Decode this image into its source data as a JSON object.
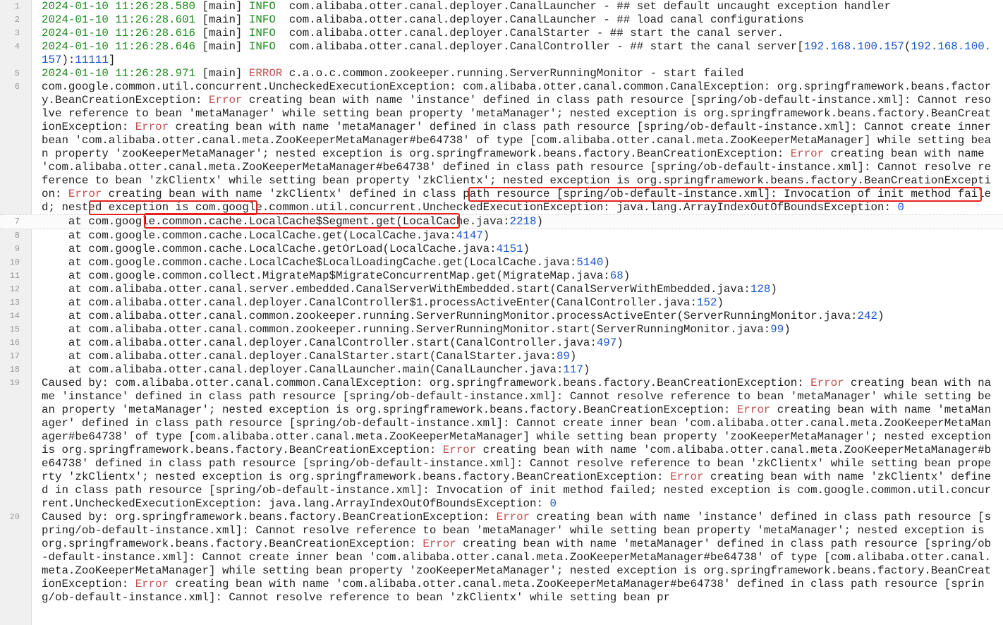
{
  "lines": [
    {
      "n": "1",
      "segs": [
        {
          "t": "2024-01-10 11:26:28.580",
          "c": "ts"
        },
        {
          "t": " [main] "
        },
        {
          "t": "INFO",
          "c": "info"
        },
        {
          "t": "  com.alibaba.otter.canal.deployer.CanalLauncher - ## set default uncaught exception handler"
        }
      ]
    },
    {
      "n": "2",
      "segs": [
        {
          "t": "2024-01-10 11:26:28.601",
          "c": "ts"
        },
        {
          "t": " [main] "
        },
        {
          "t": "INFO",
          "c": "info"
        },
        {
          "t": "  com.alibaba.otter.canal.deployer.CanalLauncher - ## load canal configurations"
        }
      ]
    },
    {
      "n": "3",
      "segs": [
        {
          "t": "2024-01-10 11:26:28.616",
          "c": "ts"
        },
        {
          "t": " [main] "
        },
        {
          "t": "INFO",
          "c": "info"
        },
        {
          "t": "  com.alibaba.otter.canal.deployer.CanalStarter - ## start the canal server."
        }
      ]
    },
    {
      "n": "4",
      "segs": [
        {
          "t": "2024-01-10 11:26:28.646",
          "c": "ts"
        },
        {
          "t": " [main] "
        },
        {
          "t": "INFO",
          "c": "info"
        },
        {
          "t": "  com.alibaba.otter.canal.deployer.CanalController - ## start the canal server["
        },
        {
          "t": "192.168.100.157",
          "c": "num"
        },
        {
          "t": "("
        },
        {
          "t": "192.168.100.157",
          "c": "num"
        },
        {
          "t": "):"
        },
        {
          "t": "11111",
          "c": "num"
        },
        {
          "t": "]"
        }
      ]
    },
    {
      "n": "5",
      "segs": [
        {
          "t": "2024-01-10 11:26:28.971",
          "c": "ts"
        },
        {
          "t": " [main] "
        },
        {
          "t": "ERROR",
          "c": "err"
        },
        {
          "t": " c.a.o.c.common.zookeeper.running.ServerRunningMonitor - start failed"
        }
      ]
    },
    {
      "n": "6",
      "segs": [
        {
          "t": "com.google.common.util.concurrent.UncheckedExecutionException: com.alibaba.otter.canal.common.CanalException: org.springframework.beans.factory.BeanCreationException: "
        },
        {
          "t": "Error",
          "c": "err"
        },
        {
          "t": " creating bean with name 'instance' defined in class path resource [spring/ob-default-instance.xml]: Cannot resolve reference to bean 'metaManager' while setting bean property 'metaManager'; nested exception is org.springframework.beans.factory.BeanCreationException: "
        },
        {
          "t": "Error",
          "c": "err"
        },
        {
          "t": " creating bean with name 'metaManager' defined in class path resource [spring/ob-default-instance.xml]: Cannot create inner bean 'com.alibaba.otter.canal.meta.ZooKeeperMetaManager#be64738' of type [com.alibaba.otter.canal.meta.ZooKeeperMetaManager] while setting bean property 'zooKeeperMetaManager'; nested exception is org.springframework.beans.factory.BeanCreationException: "
        },
        {
          "t": "Error",
          "c": "err"
        },
        {
          "t": " creating bean with name 'com.alibaba.otter.canal.meta.ZooKeeperMetaManager#be64738' defined in class path resource [spring/ob-default-instance.xml]: Cannot resolve reference to bean 'zkClientx' while setting bean property 'zkClientx'; nested exception is org.springframework.beans.factory.BeanCreationException: "
        },
        {
          "t": "Error",
          "c": "err"
        },
        {
          "t": " creating bean with name 'zkClientx' defined in class path resource [spring/ob-default-instance.xml]: Invocation of init method failed; nested exception is com.google.common.util.concurrent.UncheckedExecutionException: java.lang.ArrayIndexOutOfBoundsException: "
        },
        {
          "t": "0",
          "c": "num"
        }
      ]
    },
    {
      "n": "7",
      "current": true,
      "segs": [
        {
          "t": "    at com.google.common.cache.LocalCache$Segment.get(LocalCache.java:"
        },
        {
          "t": "2218",
          "c": "num"
        },
        {
          "t": ")"
        }
      ]
    },
    {
      "n": "8",
      "segs": [
        {
          "t": "    at com.google.common.cache.LocalCache.get(LocalCache.java:"
        },
        {
          "t": "4147",
          "c": "num"
        },
        {
          "t": ")"
        }
      ]
    },
    {
      "n": "9",
      "segs": [
        {
          "t": "    at com.google.common.cache.LocalCache.getOrLoad(LocalCache.java:"
        },
        {
          "t": "4151",
          "c": "num"
        },
        {
          "t": ")"
        }
      ]
    },
    {
      "n": "10",
      "segs": [
        {
          "t": "    at com.google.common.cache.LocalCache$LocalLoadingCache.get(LocalCache.java:"
        },
        {
          "t": "5140",
          "c": "num"
        },
        {
          "t": ")"
        }
      ]
    },
    {
      "n": "11",
      "segs": [
        {
          "t": "    at com.google.common.collect.MigrateMap$MigrateConcurrentMap.get(MigrateMap.java:"
        },
        {
          "t": "68",
          "c": "num"
        },
        {
          "t": ")"
        }
      ]
    },
    {
      "n": "12",
      "segs": [
        {
          "t": "    at com.alibaba.otter.canal.server.embedded.CanalServerWithEmbedded.start(CanalServerWithEmbedded.java:"
        },
        {
          "t": "128",
          "c": "num"
        },
        {
          "t": ")"
        }
      ]
    },
    {
      "n": "13",
      "segs": [
        {
          "t": "    at com.alibaba.otter.canal.deployer.CanalController$1.processActiveEnter(CanalController.java:"
        },
        {
          "t": "152",
          "c": "num"
        },
        {
          "t": ")"
        }
      ]
    },
    {
      "n": "14",
      "segs": [
        {
          "t": "    at com.alibaba.otter.canal.common.zookeeper.running.ServerRunningMonitor.processActiveEnter(ServerRunningMonitor.java:"
        },
        {
          "t": "242",
          "c": "num"
        },
        {
          "t": ")"
        }
      ]
    },
    {
      "n": "15",
      "segs": [
        {
          "t": "    at com.alibaba.otter.canal.common.zookeeper.running.ServerRunningMonitor.start(ServerRunningMonitor.java:"
        },
        {
          "t": "99",
          "c": "num"
        },
        {
          "t": ")"
        }
      ]
    },
    {
      "n": "16",
      "segs": [
        {
          "t": "    at com.alibaba.otter.canal.deployer.CanalController.start(CanalController.java:"
        },
        {
          "t": "497",
          "c": "num"
        },
        {
          "t": ")"
        }
      ]
    },
    {
      "n": "17",
      "segs": [
        {
          "t": "    at com.alibaba.otter.canal.deployer.CanalStarter.start(CanalStarter.java:"
        },
        {
          "t": "89",
          "c": "num"
        },
        {
          "t": ")"
        }
      ]
    },
    {
      "n": "18",
      "segs": [
        {
          "t": "    at com.alibaba.otter.canal.deployer.CanalLauncher.main(CanalLauncher.java:"
        },
        {
          "t": "117",
          "c": "num"
        },
        {
          "t": ")"
        }
      ]
    },
    {
      "n": "19",
      "segs": [
        {
          "t": "Caused by: com.alibaba.otter.canal.common.CanalException: org.springframework.beans.factory.BeanCreationException: "
        },
        {
          "t": "Error",
          "c": "err"
        },
        {
          "t": " creating bean with name 'instance' defined in class path resource [spring/ob-default-instance.xml]: Cannot resolve reference to bean 'metaManager' while setting bean property 'metaManager'; nested exception is org.springframework.beans.factory.BeanCreationException: "
        },
        {
          "t": "Error",
          "c": "err"
        },
        {
          "t": " creating bean with name 'metaManager' defined in class path resource [spring/ob-default-instance.xml]: Cannot create inner bean 'com.alibaba.otter.canal.meta.ZooKeeperMetaManager#be64738' of type [com.alibaba.otter.canal.meta.ZooKeeperMetaManager] while setting bean property 'zooKeeperMetaManager'; nested exception is org.springframework.beans.factory.BeanCreationException: "
        },
        {
          "t": "Error",
          "c": "err"
        },
        {
          "t": " creating bean with name 'com.alibaba.otter.canal.meta.ZooKeeperMetaManager#be64738' defined in class path resource [spring/ob-default-instance.xml]: Cannot resolve reference to bean 'zkClientx' while setting bean property 'zkClientx'; nested exception is org.springframework.beans.factory.BeanCreationException: "
        },
        {
          "t": "Error",
          "c": "err"
        },
        {
          "t": " creating bean with name 'zkClientx' defined in class path resource [spring/ob-default-instance.xml]: Invocation of init method failed; nested exception is com.google.common.util.concurrent.UncheckedExecutionException: java.lang.ArrayIndexOutOfBoundsException: "
        },
        {
          "t": "0",
          "c": "num"
        }
      ]
    },
    {
      "n": "20",
      "segs": [
        {
          "t": "Caused by: org.springframework.beans.factory.BeanCreationException: "
        },
        {
          "t": "Error",
          "c": "err"
        },
        {
          "t": " creating bean with name 'instance' defined in class path resource [spring/ob-default-instance.xml]: Cannot resolve reference to bean 'metaManager' while setting bean property 'metaManager'; nested exception is org.springframework.beans.factory.BeanCreationException: "
        },
        {
          "t": "Error",
          "c": "err"
        },
        {
          "t": " creating bean with name 'metaManager' defined in class path resource [spring/ob-default-instance.xml]: Cannot create inner bean 'com.alibaba.otter.canal.meta.ZooKeeperMetaManager#be64738' of type [com.alibaba.otter.canal.meta.ZooKeeperMetaManager] while setting bean property 'zooKeeperMetaManager'; nested exception is org.springframework.beans.factory.BeanCreationException: "
        },
        {
          "t": "Error",
          "c": "err"
        },
        {
          "t": " creating bean with name 'com.alibaba.otter.canal.meta.ZooKeeperMetaManager#be64738' defined in class path resource [spring/ob-default-instance.xml]: Cannot resolve reference to bean 'zkClientx' while setting bean pr"
        }
      ]
    }
  ],
  "colors": {
    "timestamp": "#1b8a1b",
    "error": "#c0504d",
    "number": "#1a56c8",
    "highlight_box": "#e8201a"
  }
}
